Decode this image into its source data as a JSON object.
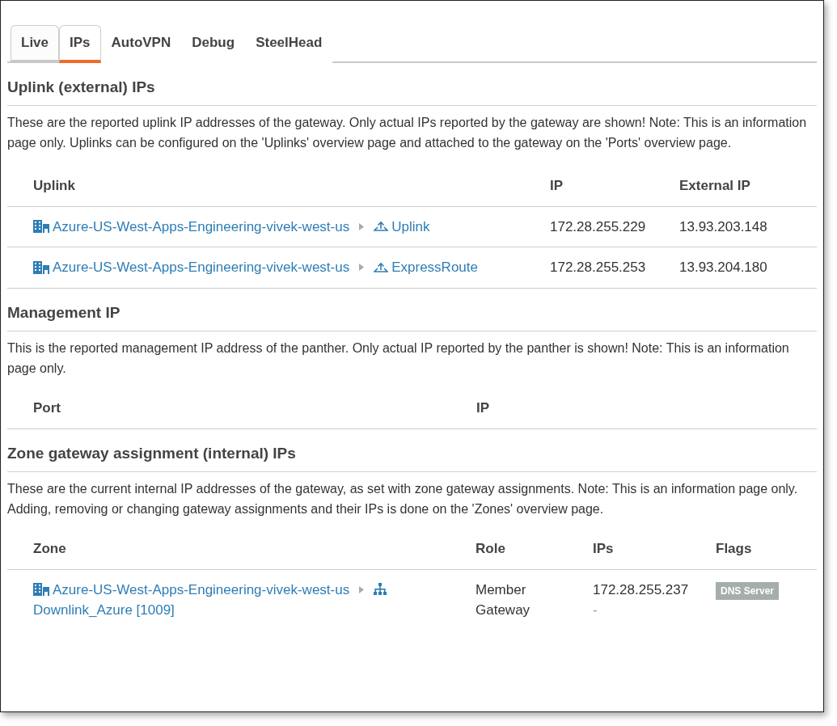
{
  "tabs": [
    {
      "label": "Live",
      "selected": false,
      "hovered": true
    },
    {
      "label": "IPs",
      "selected": true,
      "hovered": false
    },
    {
      "label": "AutoVPN",
      "selected": false,
      "hovered": false
    },
    {
      "label": "Debug",
      "selected": false,
      "hovered": false
    },
    {
      "label": "SteelHead",
      "selected": false,
      "hovered": false
    }
  ],
  "uplink": {
    "title": "Uplink (external) IPs",
    "description": "These are the reported uplink IP addresses of the gateway. Only actual IPs reported by the gateway are shown! Note: This is an information page only. Uplinks can be configured on the 'Uplinks' overview page and attached to the gateway on the 'Ports' overview page.",
    "columns": [
      "Uplink",
      "IP",
      "External IP"
    ],
    "rows": [
      {
        "gateway": "Azure-US-West-Apps-Engineering-vivek-west-us",
        "uplink": "Uplink",
        "ip": "172.28.255.229",
        "external_ip": "13.93.203.148"
      },
      {
        "gateway": "Azure-US-West-Apps-Engineering-vivek-west-us",
        "uplink": "ExpressRoute",
        "ip": "172.28.255.253",
        "external_ip": "13.93.204.180"
      }
    ]
  },
  "management": {
    "title": "Management IP",
    "description": "This is the reported management IP address of the panther. Only actual IP reported by the panther is shown! Note: This is an information page only.",
    "columns": [
      "Port",
      "IP"
    ]
  },
  "zones": {
    "title": "Zone gateway assignment (internal) IPs",
    "description": "These are the current internal IP addresses of the gateway, as set with zone gateway assignments. Note: This is an information page only. Adding, removing or changing gateway assignments and their IPs is done on the 'Zones' overview page.",
    "columns": [
      "Zone",
      "Role",
      "IPs",
      "Flags"
    ],
    "rows": [
      {
        "gateway": "Azure-US-West-Apps-Engineering-vivek-west-us",
        "zone": "Downlink_Azure [1009]",
        "role": "Member Gateway",
        "ips": [
          "172.28.255.237",
          "-"
        ],
        "flags": [
          "DNS Server"
        ]
      }
    ]
  }
}
